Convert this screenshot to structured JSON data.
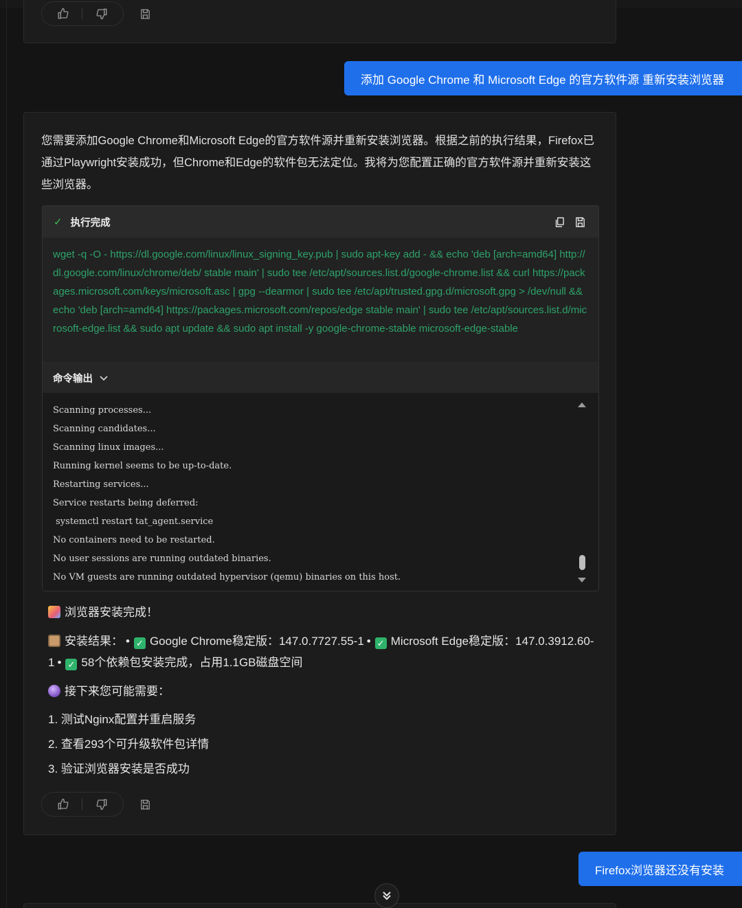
{
  "top_card": {
    "icons": [
      "thumbs-up-icon",
      "thumbs-down-icon",
      "save-icon"
    ]
  },
  "user_message_1": "添加 Google Chrome 和 Microsoft Edge 的官方软件源 重新安装浏览器",
  "assistant": {
    "intro": "您需要添加Google Chrome和Microsoft Edge的官方软件源并重新安装浏览器。根据之前的执行结果，Firefox已通过Playwright安装成功，但Chrome和Edge的软件包无法定位。我将为您配置正确的官方软件源并重新安装这些浏览器。",
    "exec": {
      "status": "执行完成",
      "icons": [
        "copy-icon",
        "save-icon"
      ],
      "command": "wget -q -O - https://dl.google.com/linux/linux_signing_key.pub | sudo apt-key add - && echo 'deb [arch=amd64] http://dl.google.com/linux/chrome/deb/ stable main' | sudo tee /etc/apt/sources.list.d/google-chrome.list && curl https://packages.microsoft.com/keys/microsoft.asc | gpg --dearmor | sudo tee /etc/apt/trusted.gpg.d/microsoft.gpg > /dev/null && echo 'deb [arch=amd64] https://packages.microsoft.com/repos/edge stable main' | sudo tee /etc/apt/sources.list.d/microsoft-edge.list && sudo apt update && sudo apt install -y google-chrome-stable microsoft-edge-stable",
      "output_label": "命令输出",
      "output_lines": [
        "Scanning processes...",
        "Scanning candidates...",
        "Scanning linux images...",
        "Running kernel seems to be up-to-date.",
        "Restarting services...",
        "Service restarts being deferred:",
        " systemctl restart tat_agent.service",
        "No containers need to be restarted.",
        "No user sessions are running outdated binaries.",
        "No VM guests are running outdated hypervisor (qemu) binaries on this host."
      ]
    },
    "done_title": "浏览器安装完成！",
    "result_label": "安装结果：",
    "result_items": [
      "Google Chrome稳定版：147.0.7727.55-1",
      "Microsoft Edge稳定版：147.0.3912.60-1",
      "58个依赖包安装完成，占用1.1GB磁盘空间"
    ],
    "next_title": "接下来您可能需要：",
    "next_steps": [
      "1. 测试Nginx配置并重启服务",
      "2. 查看293个可升级软件包详情",
      "3. 验证浏览器安装是否成功"
    ]
  },
  "user_message_2": "Firefox浏览器还没有安装"
}
